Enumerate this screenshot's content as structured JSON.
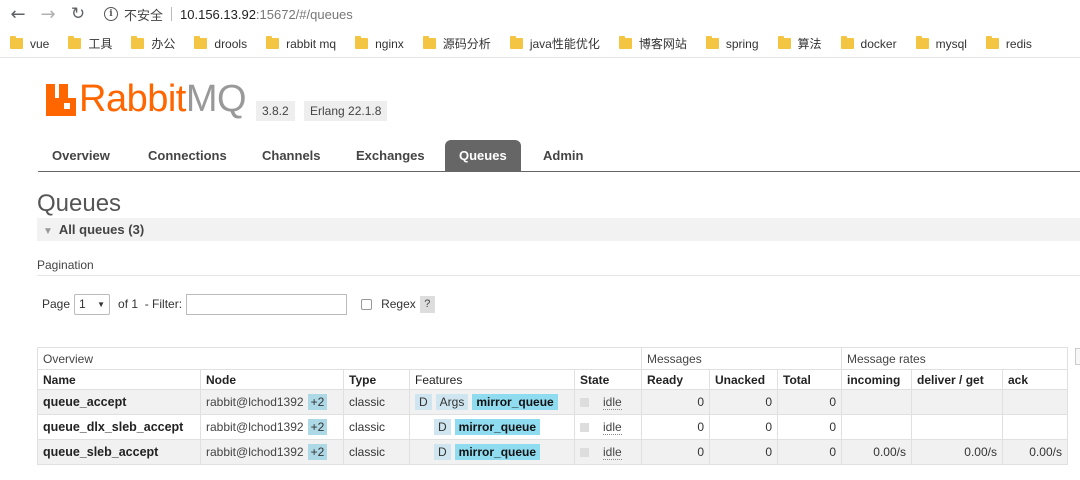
{
  "browser": {
    "insecure_label": "不安全",
    "url_host": "10.156.13.92",
    "url_rest": ":15672/#/queues",
    "bookmarks": [
      "vue",
      "工具",
      "办公",
      "drools",
      "rabbit mq",
      "nginx",
      "源码分析",
      "java性能优化",
      "博客网站",
      "spring",
      "算法",
      "docker",
      "mysql",
      "redis"
    ]
  },
  "header": {
    "logo_rabbit": "Rabbit",
    "logo_mq": "MQ",
    "version": "3.8.2",
    "erlang": "Erlang 22.1.8"
  },
  "tabs": [
    {
      "label": "Overview",
      "active": false
    },
    {
      "label": "Connections",
      "active": false
    },
    {
      "label": "Channels",
      "active": false
    },
    {
      "label": "Exchanges",
      "active": false
    },
    {
      "label": "Queues",
      "active": true
    },
    {
      "label": "Admin",
      "active": false
    }
  ],
  "page": {
    "title": "Queues",
    "section_label": "All queues (3)",
    "pagination_label": "Pagination",
    "page_label": "Page",
    "page_value": "1",
    "of_label": "of 1",
    "filter_label": "- Filter:",
    "filter_value": "",
    "regex_label": "Regex",
    "help_label": "?"
  },
  "table": {
    "groups": [
      "Overview",
      "Messages",
      "Message rates"
    ],
    "columns": [
      "Name",
      "Node",
      "Type",
      "Features",
      "State",
      "Ready",
      "Unacked",
      "Total",
      "incoming",
      "deliver / get",
      "ack"
    ],
    "rows": [
      {
        "name": "queue_accept",
        "node": "rabbit@lchod1392",
        "plus": "+2",
        "type": "classic",
        "features": [
          "D",
          "Args"
        ],
        "policy": "mirror_queue",
        "state": "idle",
        "ready": "0",
        "unacked": "0",
        "total": "0",
        "incoming": "",
        "deliver": "",
        "ack": ""
      },
      {
        "name": "queue_dlx_sleb_accept",
        "node": "rabbit@lchod1392",
        "plus": "+2",
        "type": "classic",
        "features": [
          "D"
        ],
        "policy": "mirror_queue",
        "state": "idle",
        "ready": "0",
        "unacked": "0",
        "total": "0",
        "incoming": "",
        "deliver": "",
        "ack": ""
      },
      {
        "name": "queue_sleb_accept",
        "node": "rabbit@lchod1392",
        "plus": "+2",
        "type": "classic",
        "features": [
          "D"
        ],
        "policy": "mirror_queue",
        "state": "idle",
        "ready": "0",
        "unacked": "0",
        "total": "0",
        "incoming": "0.00/s",
        "deliver": "0.00/s",
        "ack": "0.00/s"
      }
    ]
  }
}
